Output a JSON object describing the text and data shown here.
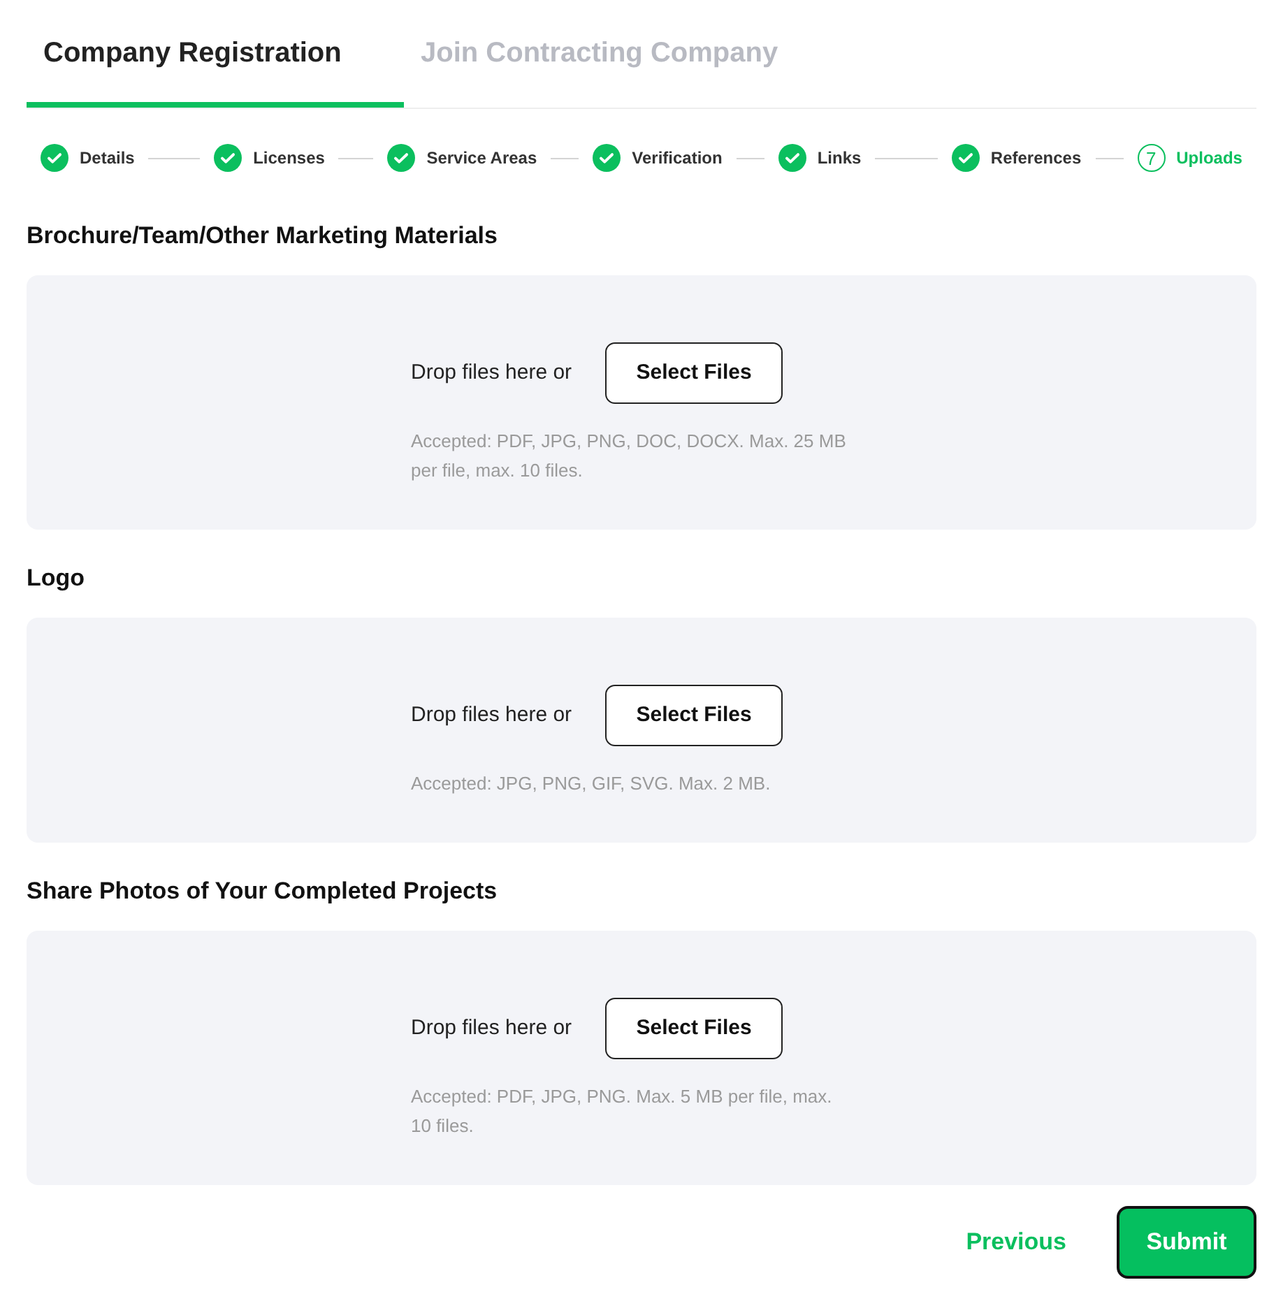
{
  "tabs": [
    {
      "label": "Company Registration",
      "selected": true
    },
    {
      "label": "Join Contracting Company",
      "selected": false
    }
  ],
  "steps": [
    {
      "label": "Details",
      "completed": true,
      "selected": false
    },
    {
      "label": "Licenses",
      "completed": true,
      "selected": false
    },
    {
      "label": "Service Areas",
      "completed": true,
      "selected": false
    },
    {
      "label": "Verification",
      "completed": true,
      "selected": false
    },
    {
      "label": "Links",
      "completed": true,
      "selected": false
    },
    {
      "label": "References",
      "completed": true,
      "selected": false
    },
    {
      "label": "Uploads",
      "completed": false,
      "selected": true,
      "number": "7"
    }
  ],
  "sections": [
    {
      "title": "Brochure/Team/Other Marketing Materials",
      "drop_text": "Drop files here or",
      "button": "Select Files",
      "hint": "Accepted: PDF, JPG, PNG, DOC, DOCX. Max. 25 MB per file, max. 10 files."
    },
    {
      "title": "Logo",
      "drop_text": "Drop files here or",
      "button": "Select Files",
      "hint": "Accepted: JPG, PNG, GIF, SVG. Max. 2 MB."
    },
    {
      "title": "Share Photos of Your Completed Projects",
      "drop_text": "Drop files here or",
      "button": "Select Files",
      "hint": "Accepted: PDF, JPG, PNG. Max. 5 MB per file, max. 10 files."
    }
  ],
  "actions": {
    "previous": "Previous",
    "submit": "Submit"
  }
}
